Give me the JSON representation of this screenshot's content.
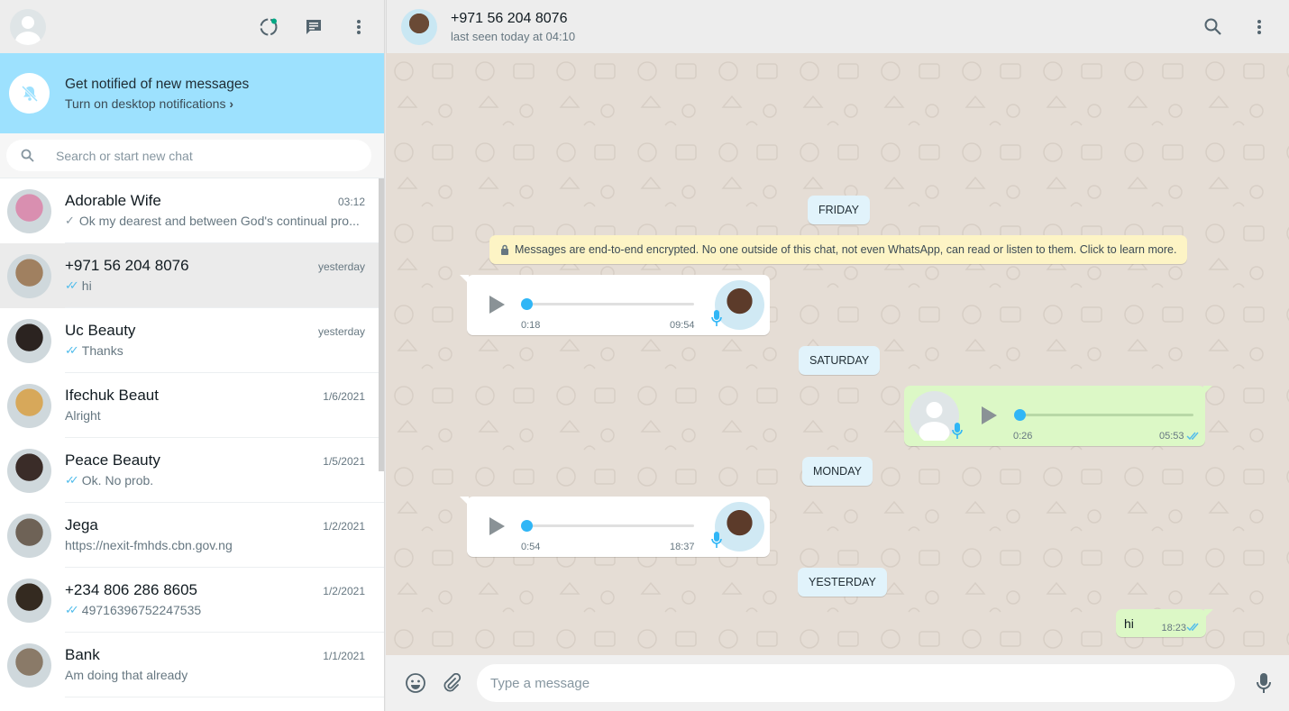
{
  "sidebar": {
    "search_placeholder": "Search or start new chat",
    "notification": {
      "title": "Get notified of new messages",
      "link": "Turn on desktop notifications"
    },
    "chats": [
      {
        "name": "Adorable Wife",
        "time": "03:12",
        "last": "Ok my dearest and between God's continual pro...",
        "tick": "single",
        "avatar_color": "#d98fb0"
      },
      {
        "name": "+971 56 204 8076",
        "time": "yesterday",
        "last": "hi",
        "tick": "double-blue",
        "avatar_color": "#a08060",
        "active": true
      },
      {
        "name": "Uc Beauty",
        "time": "yesterday",
        "last": "Thanks",
        "tick": "double-blue",
        "avatar_color": "#2b2320"
      },
      {
        "name": "Ifechuk Beaut",
        "time": "1/6/2021",
        "last": "Alright",
        "tick": "none",
        "avatar_color": "#d7a85a"
      },
      {
        "name": "Peace Beauty",
        "time": "1/5/2021",
        "last": "Ok. No prob.",
        "tick": "double-blue",
        "avatar_color": "#3a2c28"
      },
      {
        "name": "Jega",
        "time": "1/2/2021",
        "last": "https://nexit-fmhds.cbn.gov.ng",
        "tick": "none",
        "avatar_color": "#6e6256"
      },
      {
        "name": "+234 806 286 8605",
        "time": "1/2/2021",
        "last": "49716396752247535",
        "tick": "double-blue",
        "avatar_color": "#342a20"
      },
      {
        "name": "Bank",
        "time": "1/1/2021",
        "last": "Am doing that already",
        "tick": "none",
        "avatar_color": "#8a7a68"
      }
    ]
  },
  "conversation": {
    "contact_name": "+971 56 204 8076",
    "last_seen": "last seen today at 04:10",
    "encryption_notice": "Messages are end-to-end encrypted. No one outside of this chat, not even WhatsApp, can read or listen to them. Click to learn more.",
    "days": {
      "friday": "FRIDAY",
      "saturday": "SATURDAY",
      "monday": "MONDAY",
      "yesterday": "YESTERDAY"
    },
    "voice_messages": [
      {
        "direction": "in",
        "duration": "0:18",
        "time": "09:54"
      },
      {
        "direction": "out",
        "duration": "0:26",
        "time": "05:53"
      },
      {
        "direction": "in",
        "duration": "0:54",
        "time": "18:37"
      }
    ],
    "text_message": {
      "text": "hi",
      "time": "18:23"
    },
    "composer_placeholder": "Type a message"
  },
  "colors": {
    "header_bg": "#ededed",
    "notify_bg": "#9de1fe",
    "outgoing_bubble": "#dcf8c6",
    "play_dot": "#30b6f6",
    "read_tick": "#53bdeb"
  }
}
